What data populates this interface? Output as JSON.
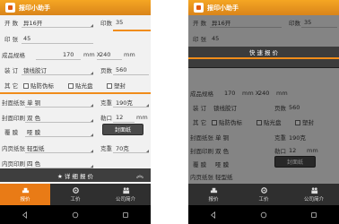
{
  "app": {
    "title": "报印小助手"
  },
  "form": {
    "kaishu": {
      "label": "开  数",
      "value": "异16开"
    },
    "yinshu": {
      "label": "印数",
      "value": "35"
    },
    "yinzhang": {
      "label": "印  张",
      "value": "45"
    },
    "chengpin": {
      "label": "成品规格",
      "w": "170",
      "x_unit": "mm X",
      "h": "240",
      "unit": "mm"
    },
    "zhuangding": {
      "label": "装  订",
      "value": "锁线胶订",
      "yeshu_label": "页数",
      "yeshu": "560"
    },
    "qita": {
      "label": "其  它",
      "opts": [
        "贴防伪标",
        "贴光盘",
        "塑封"
      ]
    },
    "fengmian_zhi": {
      "label": "封面纸张",
      "value": "单  铜",
      "ke_label": "克重",
      "ke": "190克"
    },
    "fengmian_yin": {
      "label": "封面印刷",
      "value": "双  色",
      "lekou_label": "勒口",
      "lekou": "12",
      "lekou_unit": "mm"
    },
    "fumo": {
      "label": "覆  膜",
      "value": "哑  膜"
    },
    "feng_btn": "封面纸",
    "neiwen_zhi": {
      "label": "内页纸张",
      "value": "轻型纸",
      "ke_label": "克重",
      "ke": "70克"
    },
    "neiwen_yin": {
      "label": "内页印刷",
      "value": "四  色"
    }
  },
  "detail_bar": "★ 详 细 报 价",
  "quote_header": "快 速 报 价",
  "tabs": [
    {
      "label": "报价",
      "icon": "gold-icon"
    },
    {
      "label": "工价",
      "icon": "gear-icon"
    },
    {
      "label": "公司简介",
      "icon": "people-icon"
    }
  ],
  "nav": {
    "back": "back-icon",
    "home": "home-icon",
    "recent": "recent-icon"
  },
  "colors": {
    "accent": "#f08c1a",
    "tab_active": "#e97b16",
    "dark": "#3e3e3e"
  }
}
